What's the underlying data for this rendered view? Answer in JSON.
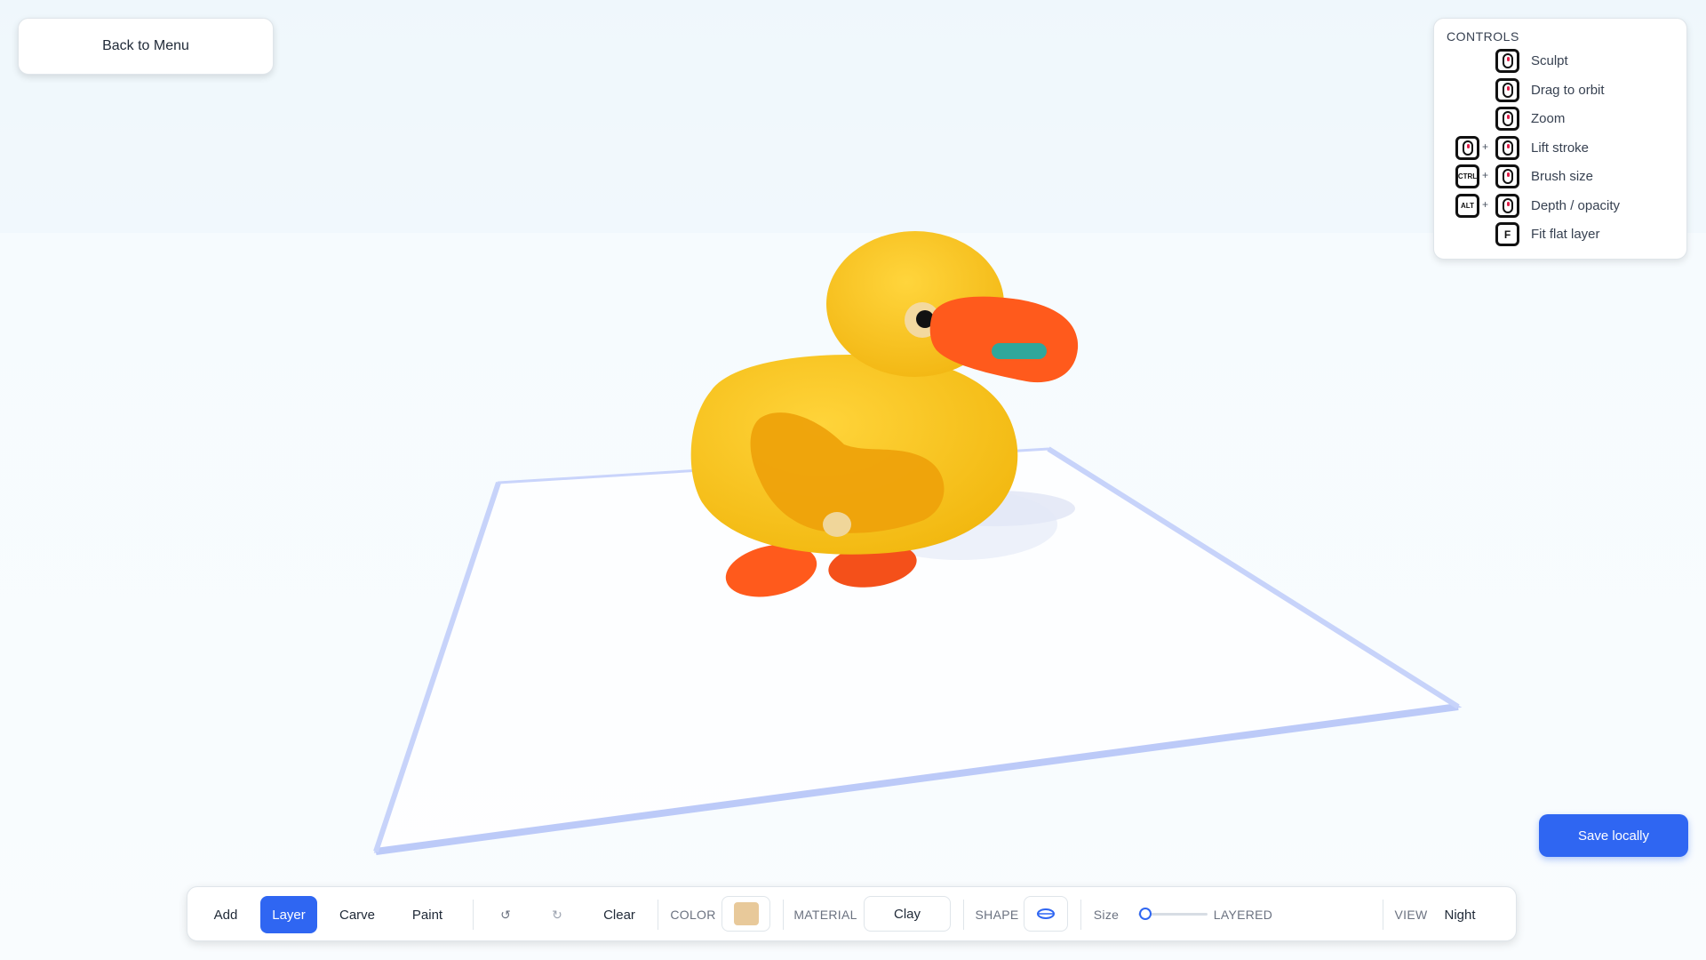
{
  "back_button": {
    "label": "Back to Menu"
  },
  "controls": {
    "title": "CONTROLS",
    "items": [
      {
        "label": "Sculpt"
      },
      {
        "label": "Drag to orbit"
      },
      {
        "label": "Zoom"
      },
      {
        "label": "Lift stroke"
      },
      {
        "label": "Brush size",
        "modifier": "CTRL"
      },
      {
        "label": "Depth / opacity",
        "modifier": "ALT"
      },
      {
        "label": "Fit flat layer",
        "key": "F"
      }
    ]
  },
  "save_button": {
    "label": "Save locally"
  },
  "toolbar": {
    "tools": {
      "add": "Add",
      "layer": "Layer",
      "carve": "Carve",
      "paint": "Paint"
    },
    "undo_icon": "↺",
    "redo_icon": "↻",
    "clear": "Clear",
    "color_label": "COLOR",
    "color_value": "#e8c99a",
    "material_label": "MATERIAL",
    "material_value": "Clay",
    "shape_label": "SHAPE",
    "size_label": "Size",
    "size_value": 0.1,
    "mode": "LAYERED",
    "view_label": "VIEW",
    "view_value": "Night"
  },
  "colors": {
    "accent": "#2f66f2",
    "duck_body": "#f8c01d",
    "duck_beak": "#ff5a1c",
    "duck_wing": "#eea20b"
  }
}
